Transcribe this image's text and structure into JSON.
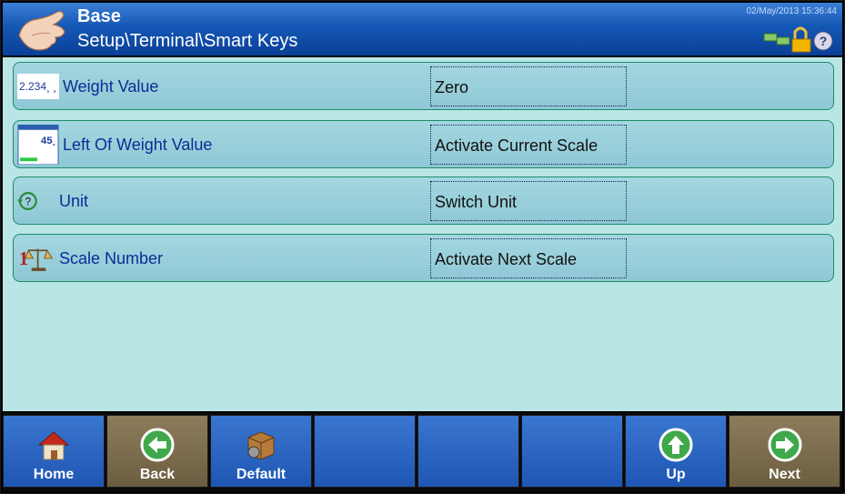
{
  "header": {
    "title": "Base",
    "path": "Setup\\Terminal\\Smart Keys",
    "datetime": "02/May/2013 15:36:44",
    "icons": [
      "network-icon",
      "lock-icon",
      "help-icon"
    ]
  },
  "rows": [
    {
      "label": "Weight Value",
      "value": "Zero",
      "icon": "weight-value-thumb-icon",
      "icon_text": "2.234¸ ¸"
    },
    {
      "label": "Left Of Weight Value",
      "value": "Activate Current Scale",
      "icon": "weight-display-thumb-icon",
      "icon_text": "45¸"
    },
    {
      "label": "Unit",
      "value": "Switch Unit",
      "icon": "unit-cycle-icon",
      "icon_text": "?"
    },
    {
      "label": "Scale Number",
      "value": "Activate Next Scale",
      "icon": "scale-number-icon",
      "icon_text": "1"
    }
  ],
  "footer": [
    {
      "label": "Home",
      "icon": "home-icon",
      "color": "blue"
    },
    {
      "label": "Back",
      "icon": "back-arrow-icon",
      "color": "tan"
    },
    {
      "label": "Default",
      "icon": "default-box-icon",
      "color": "blue"
    },
    {
      "label": "",
      "color": "blue"
    },
    {
      "label": "",
      "color": "blue"
    },
    {
      "label": "",
      "color": "blue"
    },
    {
      "label": "Up",
      "icon": "up-arrow-icon",
      "color": "blue"
    },
    {
      "label": "Next",
      "icon": "next-arrow-icon",
      "color": "tan"
    }
  ]
}
